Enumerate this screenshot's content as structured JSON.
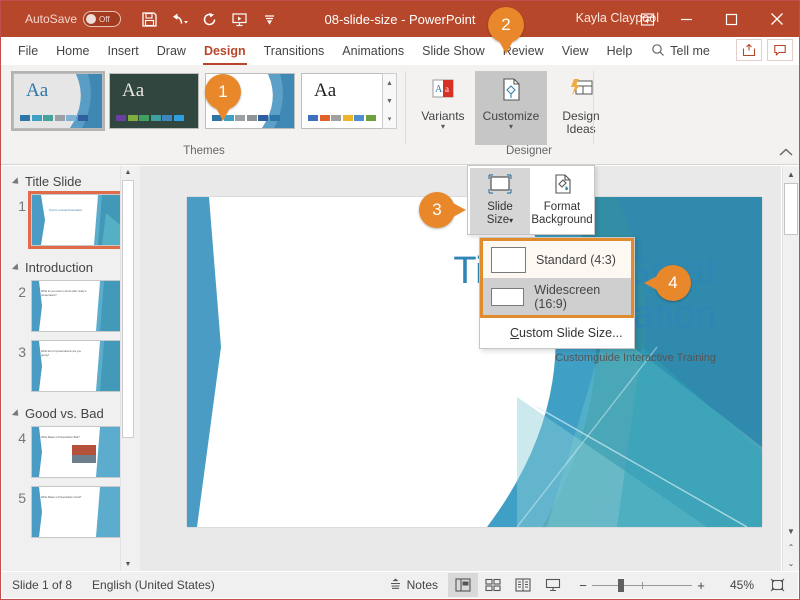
{
  "titlebar": {
    "autosave_label": "AutoSave",
    "autosave_state": "Off",
    "document_title": "08-slide-size - PowerPoint",
    "account_name": "Kayla Claypool",
    "qat": [
      {
        "name": "save-icon",
        "label": "Save"
      },
      {
        "name": "undo-icon",
        "label": "Undo"
      },
      {
        "name": "redo-icon",
        "label": "Redo"
      },
      {
        "name": "start-presentation-icon",
        "label": "Start From Beginning"
      },
      {
        "name": "customize-qat-icon",
        "label": "Customize Quick Access Toolbar"
      }
    ],
    "window_buttons": {
      "ribbon_display": "Ribbon Display Options",
      "minimize": "Minimize",
      "maximize": "Restore Down",
      "close": "Close"
    }
  },
  "tabs": [
    {
      "label": "File",
      "active": false
    },
    {
      "label": "Home",
      "active": false
    },
    {
      "label": "Insert",
      "active": false
    },
    {
      "label": "Draw",
      "active": false
    },
    {
      "label": "Design",
      "active": true
    },
    {
      "label": "Transitions",
      "active": false
    },
    {
      "label": "Animations",
      "active": false
    },
    {
      "label": "Slide Show",
      "active": false
    },
    {
      "label": "Review",
      "active": false
    },
    {
      "label": "View",
      "active": false
    },
    {
      "label": "Help",
      "active": false
    }
  ],
  "tellme": {
    "label": "Tell me"
  },
  "tab_right": {
    "share": "Share",
    "comments": "Comments"
  },
  "ribbon": {
    "themes_group_label": "Themes",
    "themes": [
      {
        "name": "theme-1",
        "aa": "Aa",
        "selected": true,
        "bg": "#ffffff",
        "aa_color": "#2e75a8",
        "wedge": "#3f8fbe",
        "swatches": [
          "#2e75a8",
          "#3f9fc4",
          "#46a29a",
          "#9aa0a4",
          "#7fb3d5",
          "#2f5f9e",
          "#2e75a8"
        ]
      },
      {
        "name": "theme-2",
        "aa": "Aa",
        "selected": false,
        "bg": "#31463f",
        "aa_color": "#e8e8e0",
        "wedge": "#2a3c36",
        "swatches": [
          "#6a3fa0",
          "#7fae3c",
          "#3fa05f",
          "#3fa0a0",
          "#3f86c0",
          "#3f6fd0",
          "#2f9fe0"
        ]
      },
      {
        "name": "theme-3",
        "aa": "Aa",
        "selected": false,
        "bg": "#ffffff",
        "aa_color": "#2e75a8",
        "wedge": "#3f8fbe",
        "swatches": [
          "#2e75a8",
          "#3f9fc4",
          "#9aa0a4",
          "#8f9499",
          "#2f5f9e",
          "#2e75a8",
          "#3f8fbe"
        ]
      },
      {
        "name": "theme-4",
        "aa": "Aa",
        "selected": false,
        "bg": "#ffffff",
        "aa_color": "#222222",
        "wedge": "#ffffff",
        "swatches": [
          "#3f6fc0",
          "#e2622a",
          "#a0a0a0",
          "#f0b429",
          "#4f8fd0",
          "#6fa03f",
          "#9ab84a"
        ]
      }
    ],
    "designer_group_label": "Designer",
    "variants": {
      "label": "Variants",
      "caret": "▾"
    },
    "customize": {
      "label": "Customize",
      "caret": "▾"
    },
    "design_ideas": {
      "label": "Design Ideas"
    },
    "collapse": "Collapse the Ribbon"
  },
  "customize_panel": {
    "slide_size": {
      "label_line1": "Slide",
      "label_line2": "Size",
      "caret": "▾"
    },
    "format_background": {
      "label_line1": "Format",
      "label_line2": "Background"
    }
  },
  "size_menu": {
    "items": [
      {
        "label": "Standard (4:3)",
        "highlighted": false,
        "ratio": "4:3"
      },
      {
        "label": "Widescreen (16:9)",
        "highlighted": true,
        "ratio": "16:9"
      }
    ],
    "custom": {
      "first_letter": "C",
      "rest": "ustom Slide Size..."
    }
  },
  "sidebar": {
    "sections": [
      {
        "title": "Title Slide",
        "slides": [
          {
            "number": "1",
            "selected": true,
            "text": "Tips for a Great Presentation",
            "kind": "title"
          }
        ]
      },
      {
        "title": "Introduction",
        "slides": [
          {
            "number": "2",
            "selected": false,
            "text": "What do you want to know after today's presentation?",
            "kind": "body"
          },
          {
            "number": "3",
            "selected": false,
            "text": "What kind of presentations are you giving?",
            "kind": "body"
          }
        ]
      },
      {
        "title": "Good vs. Bad",
        "slides": [
          {
            "number": "4",
            "selected": false,
            "text": "What Makes a Presentation Bad?",
            "kind": "body"
          },
          {
            "number": "5",
            "selected": false,
            "text": "What Makes a Presentation Good?",
            "kind": "body"
          }
        ]
      }
    ]
  },
  "slide": {
    "title_line1": "Tips for a Great",
    "title_line2": "Presentation",
    "subtitle": "Customguide Interactive Training",
    "title_color": "#2f86b5"
  },
  "status": {
    "slide_counter": "Slide 1 of 8",
    "language": "English (United States)",
    "notes": "Notes",
    "views": [
      {
        "name": "normal-view",
        "label": "Normal",
        "active": true
      },
      {
        "name": "slide-sorter-view",
        "label": "Slide Sorter",
        "active": false
      },
      {
        "name": "reading-view",
        "label": "Reading View",
        "active": false
      },
      {
        "name": "slide-show-view",
        "label": "Slide Show",
        "active": false
      }
    ],
    "zoom_out": "−",
    "zoom_in": "+",
    "zoom_level": "45%",
    "fit_label": "Fit slide to current window"
  },
  "callouts": [
    {
      "number": "1",
      "tail": "down"
    },
    {
      "number": "2",
      "tail": "down"
    },
    {
      "number": "3",
      "tail": "right"
    },
    {
      "number": "4",
      "tail": "left"
    }
  ],
  "colors": {
    "accent": "#b7472a",
    "callout": "#e8882b",
    "menu_border": "#e08b2e",
    "slide_blue": "#2f86b5"
  }
}
